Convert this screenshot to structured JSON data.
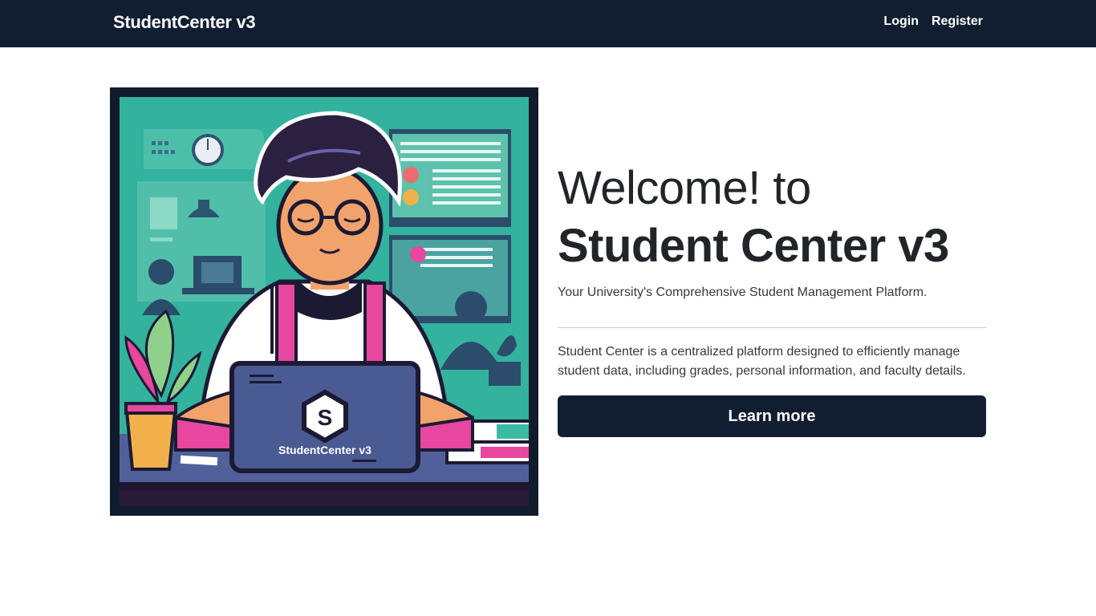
{
  "navbar": {
    "brand": "StudentCenter v3",
    "links": [
      {
        "label": "Login"
      },
      {
        "label": "Register"
      }
    ]
  },
  "hero": {
    "illustration": {
      "laptop_logo_letter": "S",
      "laptop_label": "StudentCenter v3"
    },
    "welcome": "Welcome! to",
    "title": "Student Center v3",
    "tagline": "Your University's Comprehensive Student Management Platform.",
    "description": "Student Center is a centralized platform designed to efficiently manage student data, including grades, personal information, and faculty details.",
    "cta_label": "Learn more"
  },
  "colors": {
    "nav_bg": "#111e31",
    "button_bg": "#111e31",
    "illustration_bg": "#2fae9a",
    "accent_pink": "#e7479e",
    "laptop": "#4a5a92"
  }
}
